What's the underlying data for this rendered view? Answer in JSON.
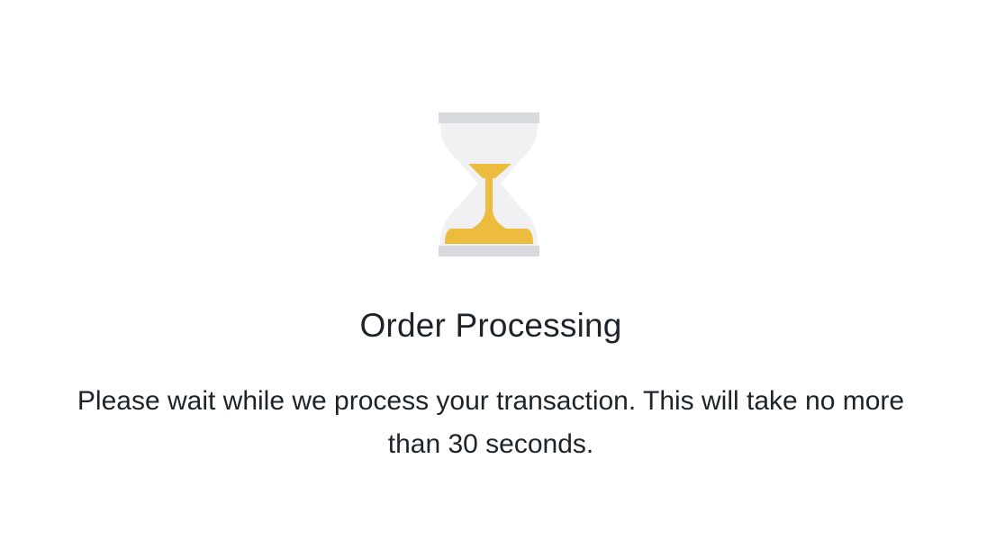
{
  "dialog": {
    "icon": "hourglass-icon",
    "title": "Order Processing",
    "message": "Please wait while we process your transaction. This will take no more than 30 seconds."
  },
  "colors": {
    "sand": "#ecbc3e",
    "glass_caps": "#d9dadf",
    "glass": "#f2f2f3",
    "text": "#1e2329",
    "background": "#ffffff"
  }
}
